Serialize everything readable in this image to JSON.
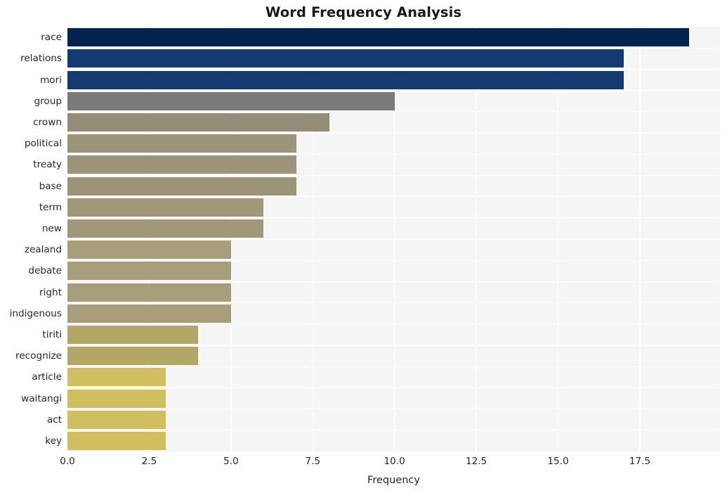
{
  "chart_data": {
    "type": "bar",
    "orientation": "horizontal",
    "title": "Word Frequency Analysis",
    "xlabel": "Frequency",
    "ylabel": "",
    "xlim": [
      0,
      19.95
    ],
    "xticks": [
      "0.0",
      "2.5",
      "5.0",
      "7.5",
      "10.0",
      "12.5",
      "15.0",
      "17.5"
    ],
    "xtick_values": [
      0,
      2.5,
      5,
      7.5,
      10,
      12.5,
      15,
      17.5
    ],
    "grid": true,
    "grid_color": "#ffffff",
    "plot_background": "#f5f5f5",
    "figure_background": "#ffffff",
    "legend": false,
    "categories": [
      "race",
      "relations",
      "mori",
      "group",
      "crown",
      "political",
      "treaty",
      "base",
      "term",
      "new",
      "zealand",
      "debate",
      "right",
      "indigenous",
      "tiriti",
      "recognize",
      "article",
      "waitangi",
      "act",
      "key"
    ],
    "values": [
      19,
      17,
      17,
      10,
      8,
      7,
      7,
      7,
      6,
      6,
      5,
      5,
      5,
      5,
      4,
      4,
      3,
      3,
      3,
      3
    ],
    "bar_colors": [
      "#04244f",
      "#143a72",
      "#153a72",
      "#7a7a7a",
      "#938d78",
      "#9c9478",
      "#9c9478",
      "#9c9478",
      "#a19879",
      "#a19879",
      "#a89e7b",
      "#a89e7b",
      "#a89e7b",
      "#a89e7b",
      "#b3a768",
      "#b3a768",
      "#d1bf5f",
      "#d1bf5f",
      "#d1bf5f",
      "#d1bf5f"
    ]
  }
}
